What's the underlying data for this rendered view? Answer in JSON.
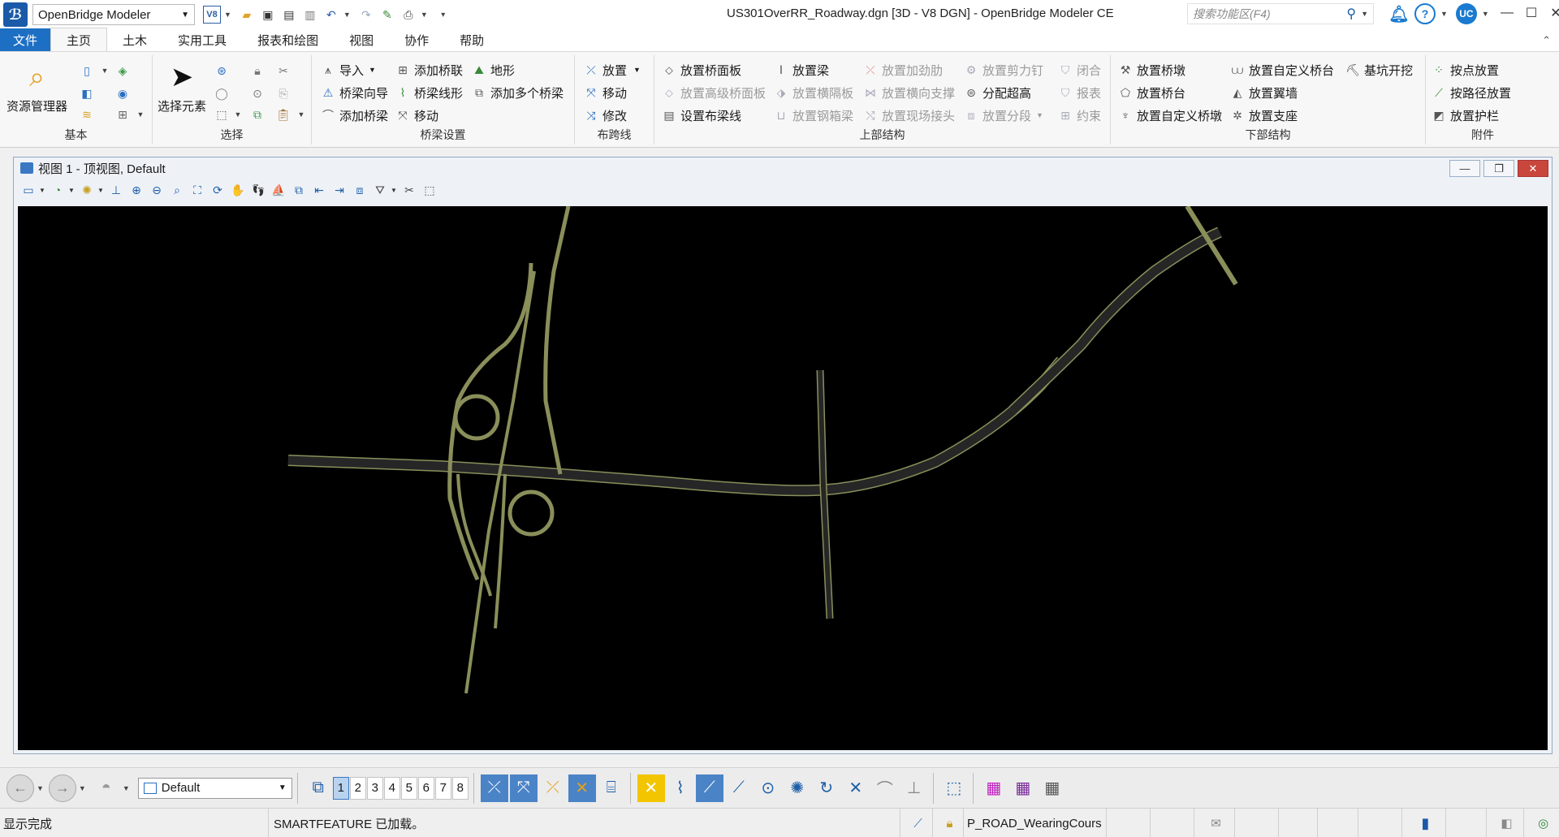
{
  "app": {
    "workspace": "OpenBridge Modeler",
    "window_title": "US301OverRR_Roadway.dgn [3D - V8 DGN] - OpenBridge Modeler CE",
    "search_placeholder": "搜索功能区(F4)",
    "user_initials": "UC"
  },
  "tabs": [
    "文件",
    "主页",
    "土木",
    "实用工具",
    "报表和绘图",
    "视图",
    "协作",
    "帮助"
  ],
  "ribbon": {
    "groups": {
      "basic": "基本",
      "select": "选择",
      "bridge_setup": "桥梁设置",
      "alignment": "布跨线",
      "superstructure": "上部结构",
      "substructure": "下部结构",
      "accessories": "附件"
    },
    "basic": {
      "resource_manager": "资源管理器"
    },
    "select": {
      "select_element": "选择元素"
    },
    "bridge_setup": {
      "import": "导入",
      "add_bridge_link": "添加桥联",
      "terrain": "地形",
      "bridge_wizard": "桥梁向导",
      "bridge_alignment": "桥梁线形",
      "add_multiple_bridges": "添加多个桥梁",
      "add_bridge": "添加桥梁",
      "move": "移动"
    },
    "alignment": {
      "place": "放置",
      "move": "移动",
      "modify": "修改"
    },
    "superstructure": {
      "place_deck": "放置桥面板",
      "place_advanced_deck": "放置高级桥面板",
      "set_layout_line": "设置布梁线",
      "place_beam": "放置梁",
      "place_diaphragm": "放置横隔板",
      "place_steel_box": "放置钢箱梁",
      "place_stiffener": "放置加劲肋",
      "place_cross_bracing": "放置横向支撑",
      "place_field_splice": "放置现场接头",
      "place_shear_stud": "放置剪力钉",
      "distribute_superelevation": "分配超高",
      "place_segment": "放置分段",
      "closure": "闭合",
      "report": "报表",
      "constraint": "约束"
    },
    "substructure": {
      "place_pier": "放置桥墩",
      "place_abutment": "放置桥台",
      "place_custom_pier": "放置自定义桥墩",
      "place_custom_abutment": "放置自定义桥台",
      "place_wingwall": "放置翼墙",
      "place_bearing": "放置支座",
      "foundation_excavation": "基坑开挖"
    },
    "accessories": {
      "place_by_point": "按点放置",
      "place_by_path": "按路径放置",
      "place_barrier": "放置护栏"
    }
  },
  "view": {
    "title": "视图 1 - 顶视图, Default"
  },
  "bottom_toolbar": {
    "view_group": "Default",
    "view_numbers": [
      "1",
      "2",
      "3",
      "4",
      "5",
      "6",
      "7",
      "8"
    ],
    "active_view": "1"
  },
  "status": {
    "message": "显示完成",
    "prompt": "SMARTFEATURE 已加载。",
    "active_level": "P_ROAD_WearingCours"
  },
  "colors": {
    "file_tab": "#1d6fc4",
    "canvas_bg": "#000000",
    "road_surface": "#2a2a2a",
    "road_edge": "#8a8f5a"
  }
}
